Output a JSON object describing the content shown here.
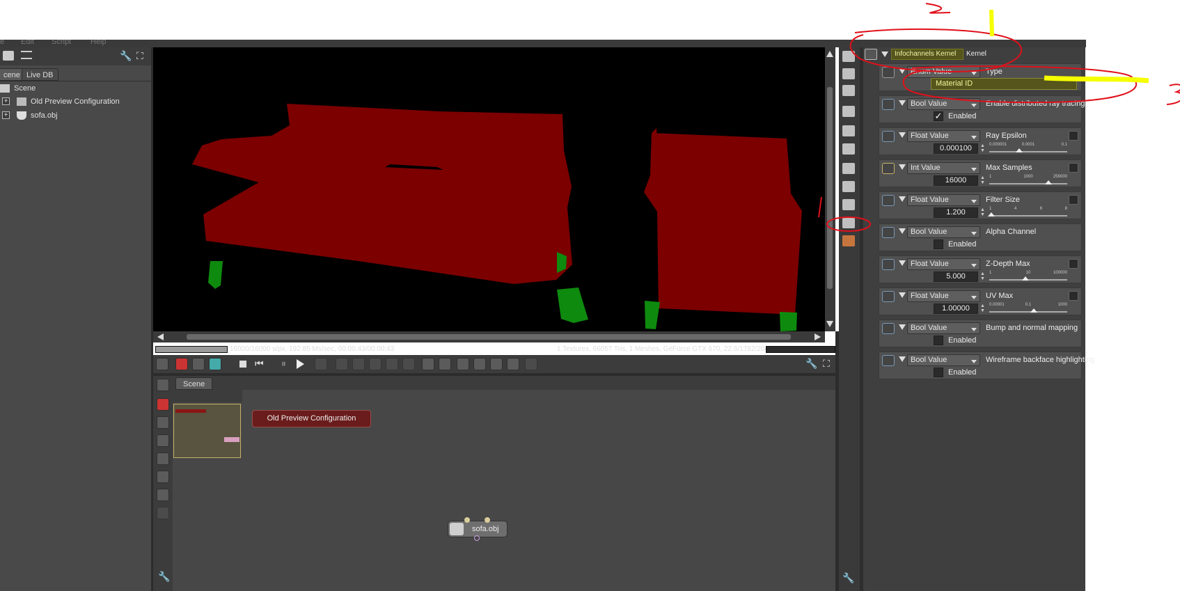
{
  "menu": [
    "e",
    "Edit",
    "Script",
    "Help"
  ],
  "left": {
    "tabs": [
      "cene",
      "Live DB"
    ],
    "tree": [
      {
        "label": "Scene",
        "expander": false
      },
      {
        "label": "Old Preview Configuration",
        "expander": true
      },
      {
        "label": "sofa.obj",
        "expander": true
      }
    ]
  },
  "viewport": {
    "status_left": "16000/16000 s/px, 192.85 Ms/sec, 00:00:43/00:00:43",
    "status_right": "1 Textures, 66057 Tris, 1 Meshes, GeForce GTX 670, 22.6/1782/2048 MB",
    "progress": 1.0
  },
  "graph": {
    "tab": "Scene",
    "nodes": [
      {
        "label": "Old Preview Configuration"
      },
      {
        "label": "sofa.obj"
      }
    ]
  },
  "kernel": {
    "header_type": "Infochannels Kernel",
    "header_label": "Kernel",
    "enum_value": "Material ID",
    "params": [
      {
        "kind": "Enum Value",
        "label": "Type"
      },
      {
        "kind": "Bool Value",
        "label": "Enable distributed ray tracing",
        "checked": true,
        "check_label": "Enabled"
      },
      {
        "kind": "Float Value",
        "label": "Ray Epsilon",
        "value": "0.000100",
        "ticks": [
          "0.000001",
          "0.0001",
          "0.1"
        ],
        "pos": 0.38
      },
      {
        "kind": "Int Value",
        "label": "Max Samples",
        "value": "16000",
        "ticks": [
          "1",
          "1000",
          "256000"
        ],
        "pos": 0.76
      },
      {
        "kind": "Float Value",
        "label": "Filter Size",
        "value": "1.200",
        "ticks": [
          "1",
          "4",
          "6",
          "8"
        ],
        "pos": 0.03
      },
      {
        "kind": "Bool Value",
        "label": "Alpha Channel",
        "checked": false,
        "check_label": "Enabled"
      },
      {
        "kind": "Float Value",
        "label": "Z-Depth Max",
        "value": "5.000",
        "ticks": [
          "1",
          "10",
          "100000"
        ],
        "pos": 0.46
      },
      {
        "kind": "Float Value",
        "label": "UV Max",
        "value": "1.00000",
        "ticks": [
          "0.00001",
          "0.1",
          "1000"
        ],
        "pos": 0.57
      },
      {
        "kind": "Bool Value",
        "label": "Bump and normal mapping",
        "checked": false,
        "check_label": "Enabled"
      },
      {
        "kind": "Bool Value",
        "label": "Wireframe backface highlighting",
        "checked": false,
        "check_label": "Enabled"
      }
    ]
  },
  "annotations": [
    "2",
    "3",
    "1"
  ],
  "colors": {
    "sofa": "#7c0000",
    "legs": "#0e8a0e",
    "annotation_red": "#e0101a",
    "highlight_yellow": "#f6ff00"
  }
}
